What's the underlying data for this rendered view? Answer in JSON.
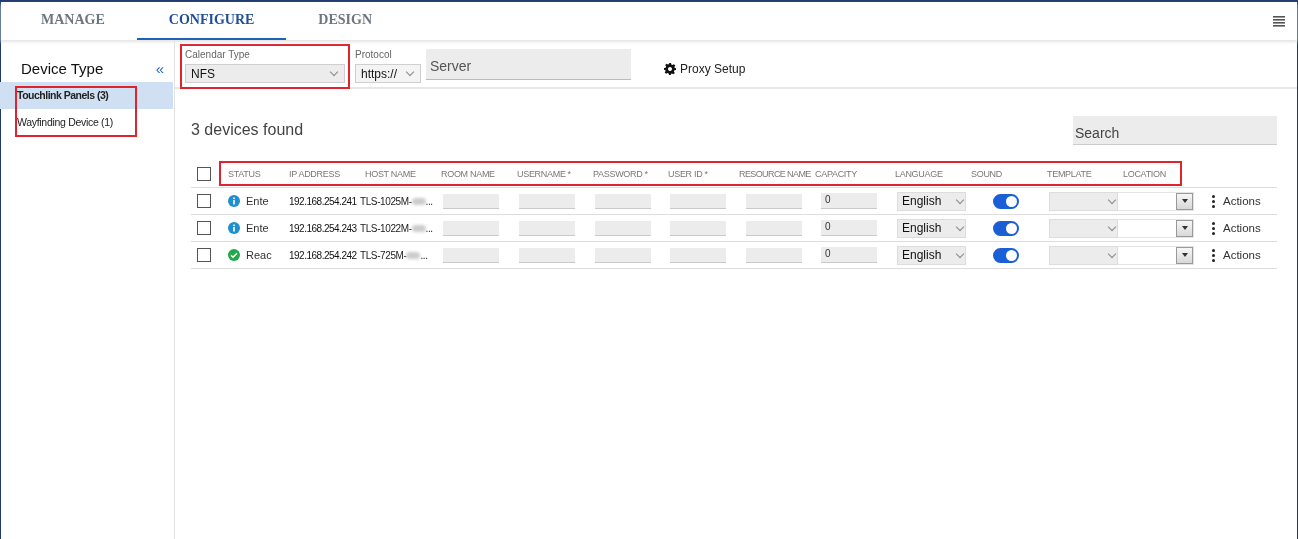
{
  "tabs": [
    {
      "label": "MANAGE",
      "selected": false
    },
    {
      "label": "CONFIGURE",
      "selected": true
    },
    {
      "label": "DESIGN",
      "selected": false
    }
  ],
  "sidebar": {
    "title": "Device Type",
    "collapse": "«",
    "highlighted": true,
    "items": [
      {
        "label": "Touchlink Panels (3)",
        "selected": true
      },
      {
        "label": "Wayfinding Device (1)",
        "selected": false
      }
    ]
  },
  "calendar_type": {
    "label": "Calendar Type",
    "value": "NFS",
    "highlighted": true
  },
  "protocol": {
    "label": "Protocol",
    "value": "https://"
  },
  "server": {
    "placeholder": "Server"
  },
  "proxy_setup": "Proxy Setup",
  "devices_found": "3 devices found",
  "search": {
    "placeholder": "Search"
  },
  "table": {
    "header_highlighted": true,
    "select_all": {
      "checked": false
    },
    "columns": [
      {
        "label": "STATUS"
      },
      {
        "label": "IP ADDRESS"
      },
      {
        "label": "HOST NAME"
      },
      {
        "label": "ROOM NAME"
      },
      {
        "label": "USERNAME",
        "required_mark": "*"
      },
      {
        "label": "PASSWORD",
        "required_mark": "*"
      },
      {
        "label": "USER ID",
        "required_mark": "*"
      },
      {
        "label": "RESOURCE NAME"
      },
      {
        "label": "CAPACITY"
      },
      {
        "label": "LANGUAGE"
      },
      {
        "label": "SOUND"
      },
      {
        "label": "TEMPLATE"
      },
      {
        "label": "LOCATION"
      }
    ],
    "rows": [
      {
        "checked": false,
        "kind": "info",
        "status_text": "Ente",
        "ip": "192.168.254.241",
        "host": "TLS-1025M-",
        "host_ellipsis": "...",
        "capacity": "0",
        "language": "English",
        "sound": true,
        "actions": "Actions"
      },
      {
        "checked": false,
        "kind": "info",
        "status_text": "Ente",
        "ip": "192.168.254.243",
        "host": "TLS-1022M-",
        "host_ellipsis": "...",
        "capacity": "0",
        "language": "English",
        "sound": true,
        "actions": "Actions"
      },
      {
        "checked": false,
        "kind": "ready",
        "status_text": "Reac",
        "ip": "192.168.254.242",
        "host": "TLS-725M-",
        "host_ellipsis": "...",
        "capacity": "0",
        "language": "English",
        "sound": true,
        "actions": "Actions"
      }
    ]
  }
}
